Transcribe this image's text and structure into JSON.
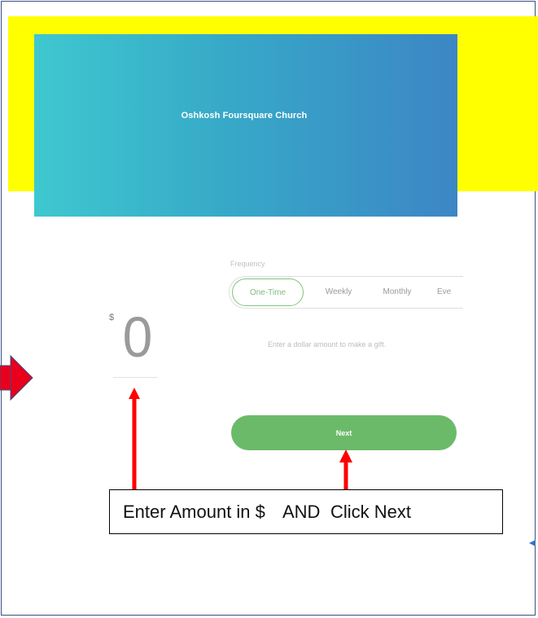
{
  "colors": {
    "highlight": "#ffff00",
    "banner_start": "#3ec8cf",
    "banner_end": "#3c86c5",
    "accent_green": "#6bba6a",
    "annotation_red": "#ff0000",
    "pointer_arrow": "#e8001c",
    "frame_border": "#3a4f86"
  },
  "banner": {
    "title": "Oshkosh Foursquare Church"
  },
  "frequency": {
    "label": "Frequency",
    "options": [
      "One-Time",
      "Weekly",
      "Monthly",
      "Eve"
    ],
    "selected": "One-Time"
  },
  "amount": {
    "currency_symbol": "$",
    "value": "0"
  },
  "hint": "Enter a dollar amount to make a gift.",
  "next_button": {
    "label": "Next"
  },
  "callout": {
    "part1": "Enter Amount in $",
    "part2": "AND",
    "part3": "Click Next"
  },
  "annotations": {
    "left_pointer_icon": "red-pointer-arrow-icon",
    "up_arrow_icon": "red-up-arrow-icon"
  }
}
